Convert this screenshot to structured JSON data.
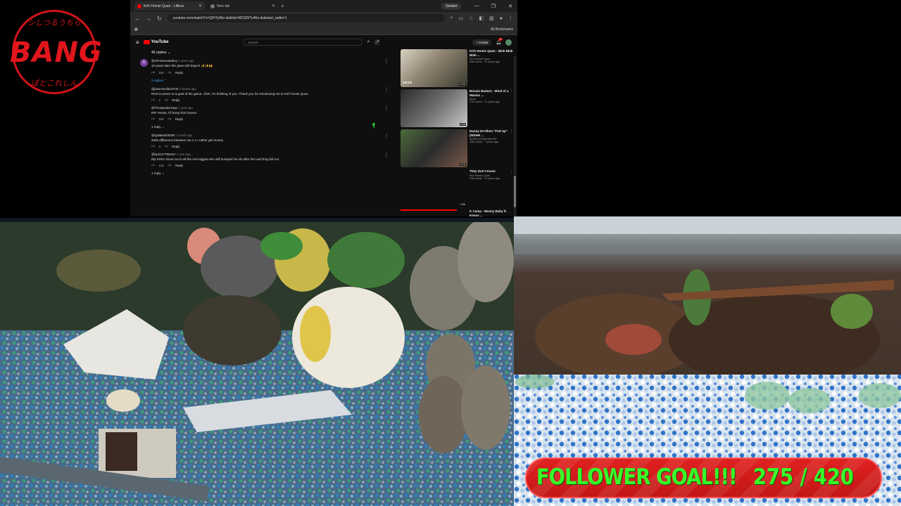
{
  "logo": {
    "text": "BANG",
    "top_script": "シしつるうちら",
    "bottom_script": "ぽとこれしん"
  },
  "browser": {
    "tabs": [
      {
        "title": "Kirh Homie Quan - Lifleve",
        "active": true
      },
      {
        "title": "New tab",
        "active": false
      }
    ],
    "gemini_label": "Gemini",
    "url": "youtube.com/watch?v=QDiTy46o-ds&list=RDQDiTy46o-ds&start_radio=1",
    "bookmarks_label": "All Bookmarks"
  },
  "youtube": {
    "search_placeholder": "Search",
    "create_label": "Create",
    "notifications_count": "9+",
    "replies_count": "46 replies",
    "comments": [
      {
        "author": "@OFreeDreamBoy",
        "age": "2 years ago",
        "avatar_letter": "G",
        "text": "10 years later this jawn still slaps!!! ✨✨🙌",
        "likes": "160",
        "reply": "Reply",
        "toggle": "2 replies"
      },
      {
        "author": "@jasonmerlalo3740",
        "age": "2 weeks ago",
        "text": "Rest in peace to a goat of the game. Chet, I'm thinking of you. Thank you for introducing me to Kirh homie Quan.",
        "likes": "2",
        "reply": "Reply"
      },
      {
        "author": "@TheSpeakerSays",
        "age": "1 year ago",
        "text": "RIP Homie, I'll bump this forever.",
        "likes": "160",
        "reply": "Reply",
        "toggle": "1 reply"
      },
      {
        "author": "@IgotBandz5280",
        "age": "1 month ago",
        "text": "2025 difference between me n u I rather get money",
        "likes": "4",
        "reply": "Reply"
      },
      {
        "author": "@Kpen1776menz",
        "age": "1 year ago",
        "text": "Rip KING    shout out to all the real niggas who still bumped his shi after him and thug fall out",
        "likes": "122",
        "reply": "Reply",
        "toggle": "1 reply"
      }
    ],
    "recommendations": [
      {
        "title": "Kirh Homie Quan - Blah Blah Blah ...",
        "channel": "Kirh Homie Quan",
        "meta": "82M views · 11 years ago",
        "duration": "3:09",
        "badge": "vevo"
      },
      {
        "title": "Boosie Badazz - Mind of a Maniac ...",
        "channel": "arlovi",
        "meta": "27M views · 11 years ago",
        "duration": "3:26",
        "badge": ""
      },
      {
        "title": "Danny De'Shon \"Fed Up\" (WSHH ...",
        "channel": "WORLDSTARHIPHOP",
        "meta": "45M views · 7 years ago",
        "duration": "3:16",
        "badge": ""
      },
      {
        "title": "They Don't Know",
        "channel": "Kirh Homie Quan",
        "meta": "37M views · 11 years ago",
        "duration": "3:56",
        "badge": ""
      },
      {
        "title": "K Camp - Money Baby ft. Kenny ...",
        "channel": "",
        "meta": "",
        "duration": "",
        "badge": ""
      }
    ]
  },
  "follower_goal": {
    "label": "FOLLOWER GOAL!!!",
    "current": 275,
    "target": 420,
    "count_text": "275 / 420"
  }
}
